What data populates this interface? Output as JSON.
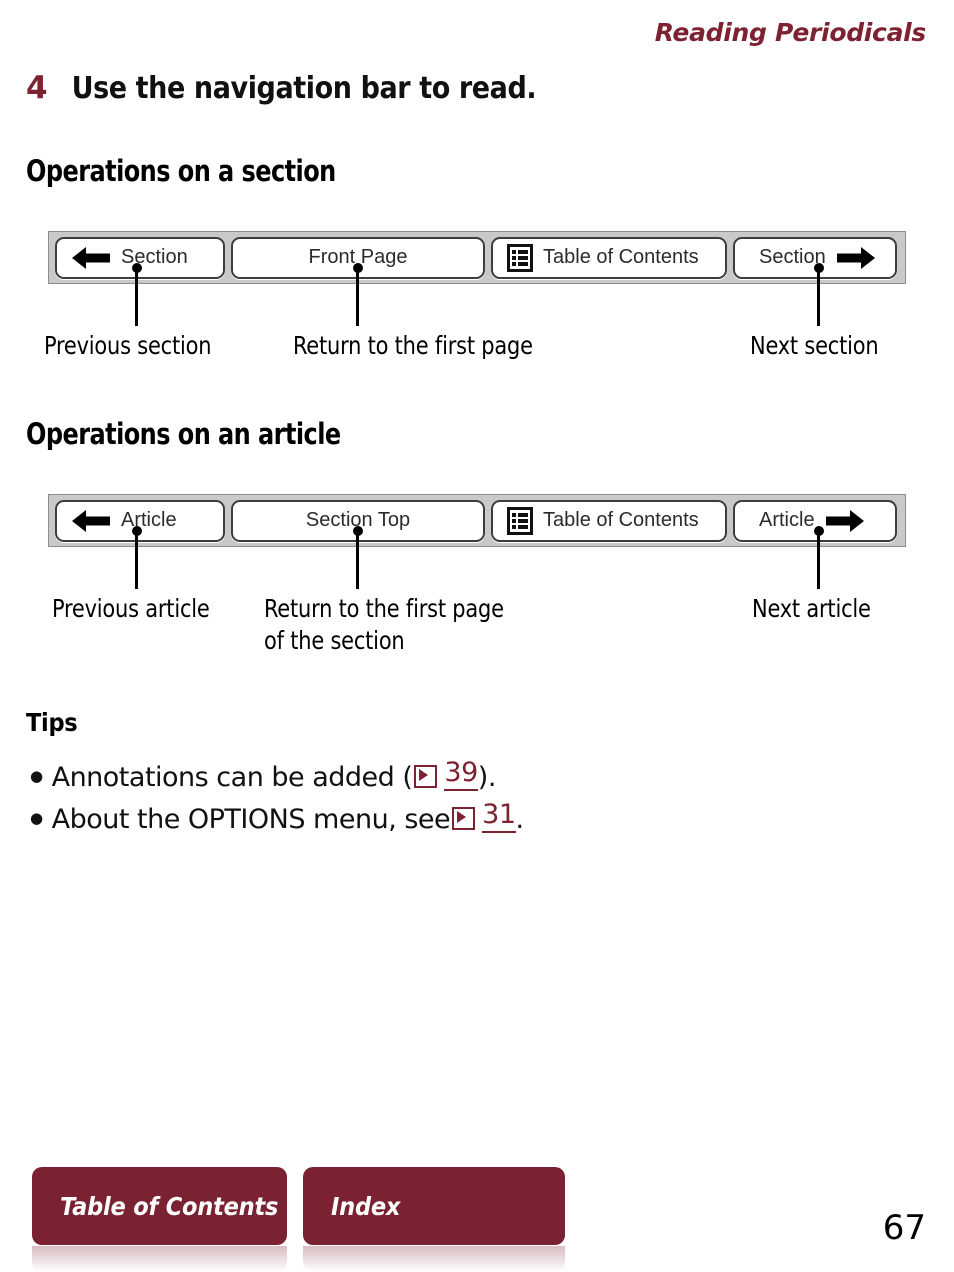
{
  "header": {
    "running_title": "Reading Periodicals",
    "accent_color": "#7d2230"
  },
  "step": {
    "number": "4",
    "title": "Use the navigation bar to read."
  },
  "sections": [
    {
      "heading": "Operations on a section",
      "navbar": {
        "buttons": [
          {
            "label": "Section",
            "icon": "left-arrow-icon",
            "icon_side": "left"
          },
          {
            "label": "Front Page",
            "icon": null,
            "icon_side": null
          },
          {
            "label": "Table of Contents",
            "icon": "table-of-contents-icon",
            "icon_side": "left"
          },
          {
            "label": "Section",
            "icon": "right-arrow-icon",
            "icon_side": "right"
          }
        ]
      },
      "callouts": [
        {
          "text": "Previous section"
        },
        {
          "text": "Return to the first page"
        },
        {
          "text": "Next section"
        }
      ]
    },
    {
      "heading": "Operations on an article",
      "navbar": {
        "buttons": [
          {
            "label": "Article",
            "icon": "left-arrow-icon",
            "icon_side": "left"
          },
          {
            "label": "Section Top",
            "icon": null,
            "icon_side": null
          },
          {
            "label": "Table of Contents",
            "icon": "table-of-contents-icon",
            "icon_side": "left"
          },
          {
            "label": "Article",
            "icon": "right-arrow-icon",
            "icon_side": "right"
          }
        ]
      },
      "callouts": [
        {
          "text": "Previous article"
        },
        {
          "text": "Return to the first page\nof the section"
        },
        {
          "text": "Next article"
        }
      ]
    }
  ],
  "tips": {
    "title": "Tips",
    "bullet_glyph": "●",
    "items": [
      {
        "prefix": "Annotations can be added (",
        "xref_icon": "cross-reference-icon",
        "page": "39",
        "suffix": ")."
      },
      {
        "prefix": "About the OPTIONS menu, see ",
        "xref_icon": "cross-reference-icon",
        "page": "31",
        "suffix": "."
      }
    ]
  },
  "footer": {
    "buttons": [
      {
        "label": "Table of Contents"
      },
      {
        "label": "Index"
      }
    ],
    "page_number": "67",
    "button_color": "#7a2231"
  }
}
